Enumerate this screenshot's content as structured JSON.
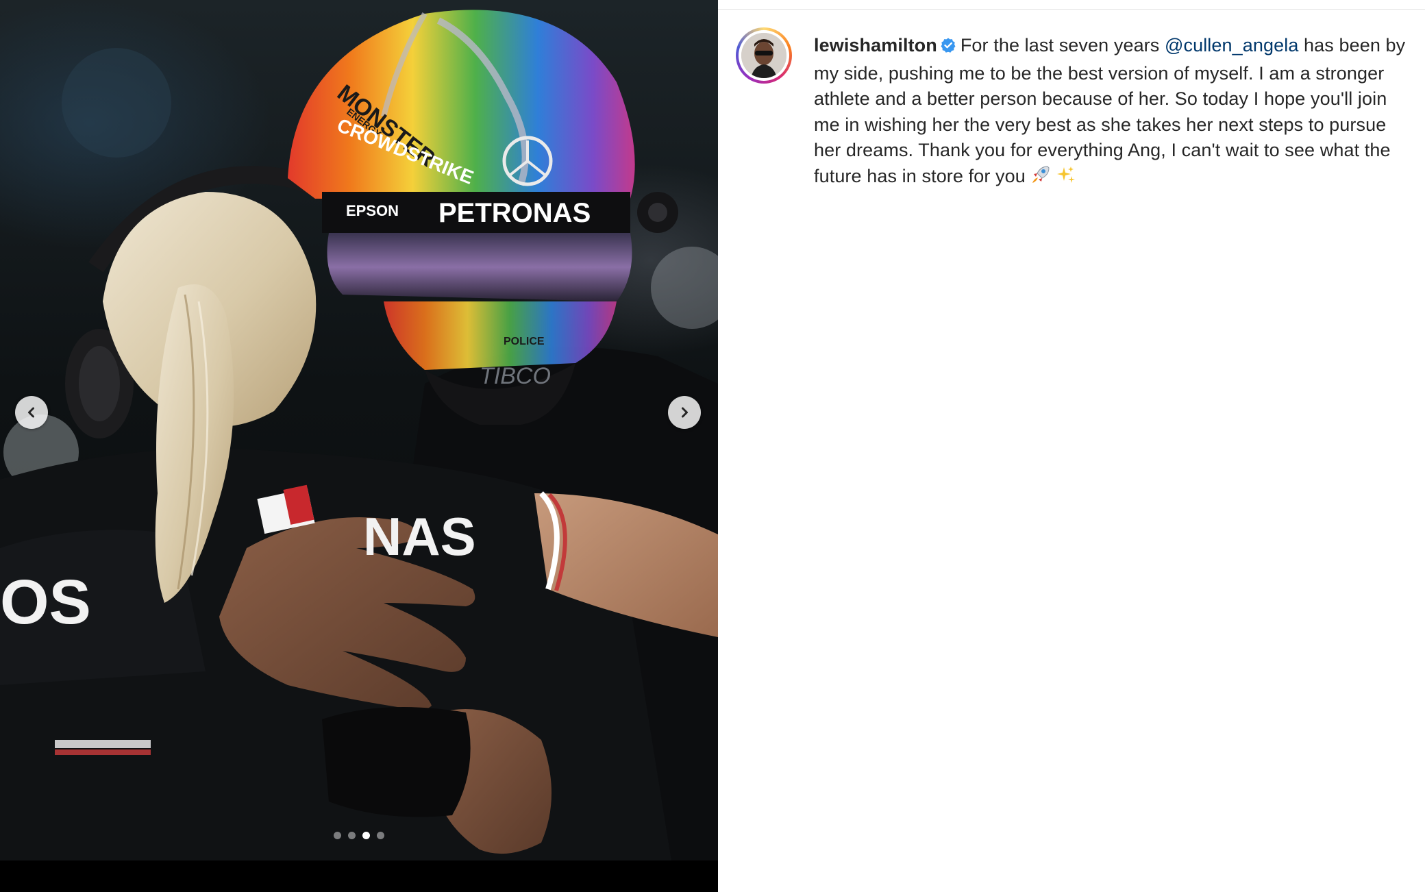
{
  "post": {
    "username": "lewishamilton",
    "verified": true,
    "caption_before_mention": "For the last seven years",
    "mention": "@cullen_angela",
    "caption_after_mention": "has been by my side, pushing me to be the best version of myself. I am a stronger athlete and a better person because of her. So today I hope you'll join me in wishing her the very best as she takes her next steps to pursue her dreams. Thank you for everything Ang, I can't wait to see what the future has in store for you",
    "caption_emojis": [
      "🚀",
      "✨"
    ]
  },
  "carousel": {
    "total_slides": 4,
    "current_slide": 3
  },
  "photo_text": {
    "helmet_sponsor": "PETRONAS",
    "helmet_brand_1": "MONSTER",
    "helmet_brand_2": "ENERGY",
    "helmet_brand_3": "CROWDSTRIKE",
    "helmet_brand_4": "EPSON",
    "helmet_brand_5": "POLICE",
    "helmet_brand_6": "TIBCO",
    "shirt_text": "NAS",
    "sleeve_text": "OS"
  },
  "colors": {
    "link": "#00376b",
    "text": "#262626",
    "verified_badge": "#3897f0"
  },
  "icons": {
    "prev": "chevron-left-icon",
    "next": "chevron-right-icon",
    "verified": "verified-badge-icon"
  }
}
